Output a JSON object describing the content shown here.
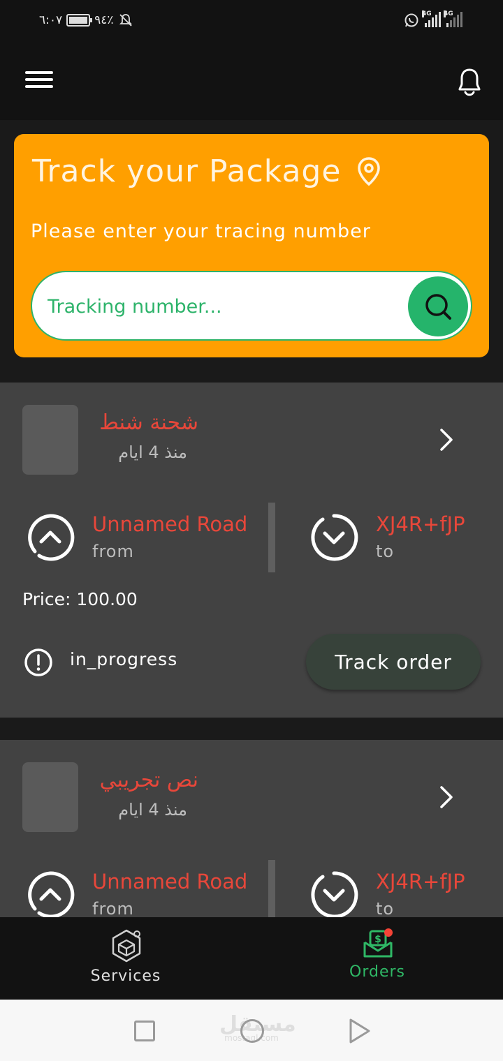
{
  "status_bar": {
    "time": "٦:٠٧",
    "battery": "٩٤٪",
    "network_1": "4G",
    "network_2": "4G",
    "icons": [
      "silent-icon",
      "battery-icon",
      "whatsapp-icon",
      "signal-icon"
    ]
  },
  "app_bar": {
    "icons": [
      "menu-icon",
      "bell-icon"
    ]
  },
  "track_card": {
    "title": "Track your Package",
    "subtitle": "Please enter your tracing number",
    "search_placeholder": "Tracking number...",
    "colors": {
      "background": "#ff9f00",
      "accent": "#25b46b"
    }
  },
  "orders": [
    {
      "name": "شحنة شنط",
      "time": "منذ 4 ايام",
      "from_road": "Unnamed Road",
      "from_label": "from",
      "to_code": "XJ4R+fJP",
      "to_label": "to",
      "price": "Price: 100.00",
      "status": "in_progress",
      "track_label": "Track order"
    },
    {
      "name": "نص تجريبي",
      "time": "منذ 4 ايام",
      "from_road": "Unnamed Road",
      "from_label": "from",
      "to_code": "XJ4R+fJP",
      "to_label": "to"
    }
  ],
  "bottom_nav": {
    "services_label": "Services",
    "orders_label": "Orders",
    "active": "Orders"
  },
  "watermark": {
    "text": "مستقل",
    "sub": "mostaql.com"
  }
}
